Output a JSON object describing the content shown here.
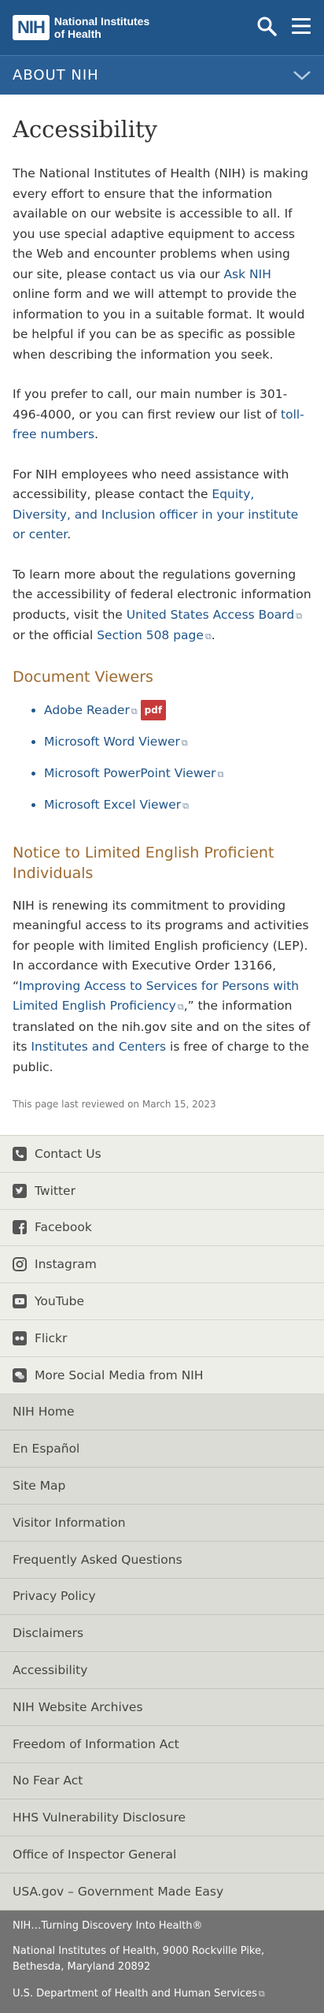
{
  "header": {
    "logo_mark": "NIH",
    "logo_line1": "National Institutes",
    "logo_line2": "of Health",
    "search_icon": "search-icon",
    "menu_icon": "hamburger-menu-icon"
  },
  "about_bar": {
    "label": "ABOUT NIH",
    "icon": "chevron-down-icon"
  },
  "page": {
    "title": "Accessibility",
    "p1_a": "The National Institutes of Health (NIH) is making every effort to ensure that the information available on our website is accessible to all. If you use special adaptive equipment to access the Web and encounter problems when using our site, please contact us via our ",
    "p1_link": "Ask NIH",
    "p1_b": " online form and we will attempt to provide the information to you in a suitable format. It would be helpful if you can be as specific as possible when describing the information you seek.",
    "p2_a": "If you prefer to call, our main number is 301-496-4000, or you can first review our list of ",
    "p2_link": "toll-free numbers",
    "p2_b": ".",
    "p3_a": "For NIH employees who need assistance with accessibility, please contact the ",
    "p3_link": "Equity, Diversity, and Inclusion officer in your institute or center",
    "p3_b": ".",
    "p4_a": "To learn more about the regulations governing the accessibility of federal electronic information products, visit the ",
    "p4_link1": "United States Access Board",
    "p4_mid": " or the official ",
    "p4_link2": "Section 508 page",
    "p4_b": ".",
    "viewers_heading": "Document Viewers",
    "viewers": [
      {
        "label": "Adobe Reader",
        "badge": "pdf"
      },
      {
        "label": "Microsoft Word Viewer"
      },
      {
        "label": "Microsoft PowerPoint Viewer"
      },
      {
        "label": "Microsoft Excel Viewer"
      }
    ],
    "lep_heading": "Notice to Limited English Proficient Individuals",
    "p5_a": "NIH is renewing its commitment to providing meaningful access to its programs and activities for people with limited English proficiency (LEP). In accordance with Executive Order 13166, “",
    "p5_link1": "Improving Access to Services for Persons with Limited English Proficiency",
    "p5_mid": ",” the information translated on the nih.gov site and on the sites of its ",
    "p5_link2": "Institutes and Centers",
    "p5_b": " is free of charge to the public.",
    "reviewed": "This page last reviewed on March 15, 2023"
  },
  "footer": {
    "social": [
      {
        "label": "Contact Us",
        "icon": "phone-icon"
      },
      {
        "label": "Twitter",
        "icon": "twitter-icon"
      },
      {
        "label": "Facebook",
        "icon": "facebook-icon"
      },
      {
        "label": "Instagram",
        "icon": "instagram-icon"
      },
      {
        "label": "YouTube",
        "icon": "youtube-icon"
      },
      {
        "label": "Flickr",
        "icon": "flickr-icon"
      },
      {
        "label": "More Social Media from NIH",
        "icon": "chat-bubbles-icon"
      }
    ],
    "nav": [
      "NIH Home",
      "En Español",
      "Site Map",
      "Visitor Information",
      "Frequently Asked Questions",
      "Privacy Policy",
      "Disclaimers",
      "Accessibility",
      "NIH Website Archives",
      "Freedom of Information Act",
      "No Fear Act",
      "HHS Vulnerability Disclosure",
      "Office of Inspector General",
      "USA.gov – Government Made Easy"
    ],
    "tagline": "NIH…Turning Discovery Into Health®",
    "address": "National Institutes of Health, 9000 Rockville Pike, Bethesda, Maryland 20892",
    "hhs": "U.S. Department of Health and Human Services"
  },
  "colors": {
    "header_blue": "#20558a",
    "link_blue": "#20558a",
    "heading_brown": "#9d6a31",
    "pdf_badge_red": "#c83a3a",
    "footer_dark": "#737373"
  }
}
